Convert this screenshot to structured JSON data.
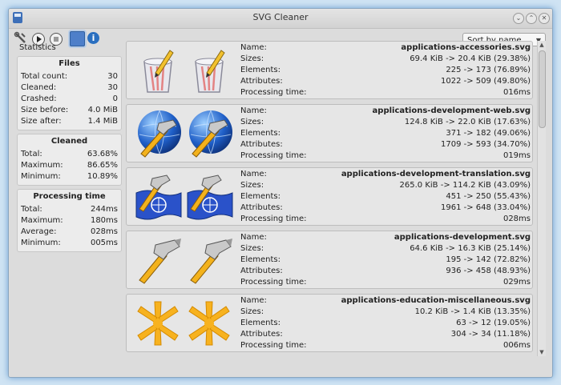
{
  "window": {
    "title": "SVG Cleaner"
  },
  "toolbar": {
    "sort_value": "Sort by name"
  },
  "stats": {
    "title": "Statistics",
    "files": {
      "title": "Files",
      "rows": [
        {
          "label": "Total count:",
          "value": "30"
        },
        {
          "label": "Cleaned:",
          "value": "30"
        },
        {
          "label": "Crashed:",
          "value": "0"
        },
        {
          "label": "Size before:",
          "value": "4.0 MiB"
        },
        {
          "label": "Size after:",
          "value": "1.4 MiB"
        }
      ]
    },
    "cleaned": {
      "title": "Cleaned",
      "rows": [
        {
          "label": "Total:",
          "value": "63.68%"
        },
        {
          "label": "Maximum:",
          "value": "86.65%"
        },
        {
          "label": "Minimum:",
          "value": "10.89%"
        }
      ]
    },
    "time": {
      "title": "Processing time",
      "rows": [
        {
          "label": "Total:",
          "value": "244ms"
        },
        {
          "label": "Maximum:",
          "value": "180ms"
        },
        {
          "label": "Average:",
          "value": "028ms"
        },
        {
          "label": "Minimum:",
          "value": "005ms"
        }
      ]
    }
  },
  "labels": {
    "name": "Name:",
    "sizes": "Sizes:",
    "elements": "Elements:",
    "attributes": "Attributes:",
    "time": "Processing time:"
  },
  "items": [
    {
      "icon": "trash-pencil-icon",
      "name": "applications-accessories.svg",
      "sizes": "69.4 KiB -> 20.4 KiB (29.38%)",
      "elements": "225 -> 173 (76.89%)",
      "attributes": "1022 -> 509 (49.80%)",
      "time": "016ms"
    },
    {
      "icon": "globe-hammer-icon",
      "name": "applications-development-web.svg",
      "sizes": "124.8 KiB -> 22.0 KiB (17.63%)",
      "elements": "371 -> 182 (49.06%)",
      "attributes": "1709 -> 593 (34.70%)",
      "time": "019ms"
    },
    {
      "icon": "flag-hammer-icon",
      "name": "applications-development-translation.svg",
      "sizes": "265.0 KiB -> 114.2 KiB (43.09%)",
      "elements": "451 -> 250 (55.43%)",
      "attributes": "1961 -> 648 (33.04%)",
      "time": "028ms"
    },
    {
      "icon": "hammer-icon",
      "name": "applications-development.svg",
      "sizes": "64.6 KiB -> 16.3 KiB (25.14%)",
      "elements": "195 -> 142 (72.82%)",
      "attributes": "936 -> 458 (48.93%)",
      "time": "029ms"
    },
    {
      "icon": "asterisk-icon",
      "name": "applications-education-miscellaneous.svg",
      "sizes": "10.2 KiB -> 1.4 KiB (13.35%)",
      "elements": "63 -> 12 (19.05%)",
      "attributes": "304 -> 34 (11.18%)",
      "time": "006ms"
    }
  ]
}
